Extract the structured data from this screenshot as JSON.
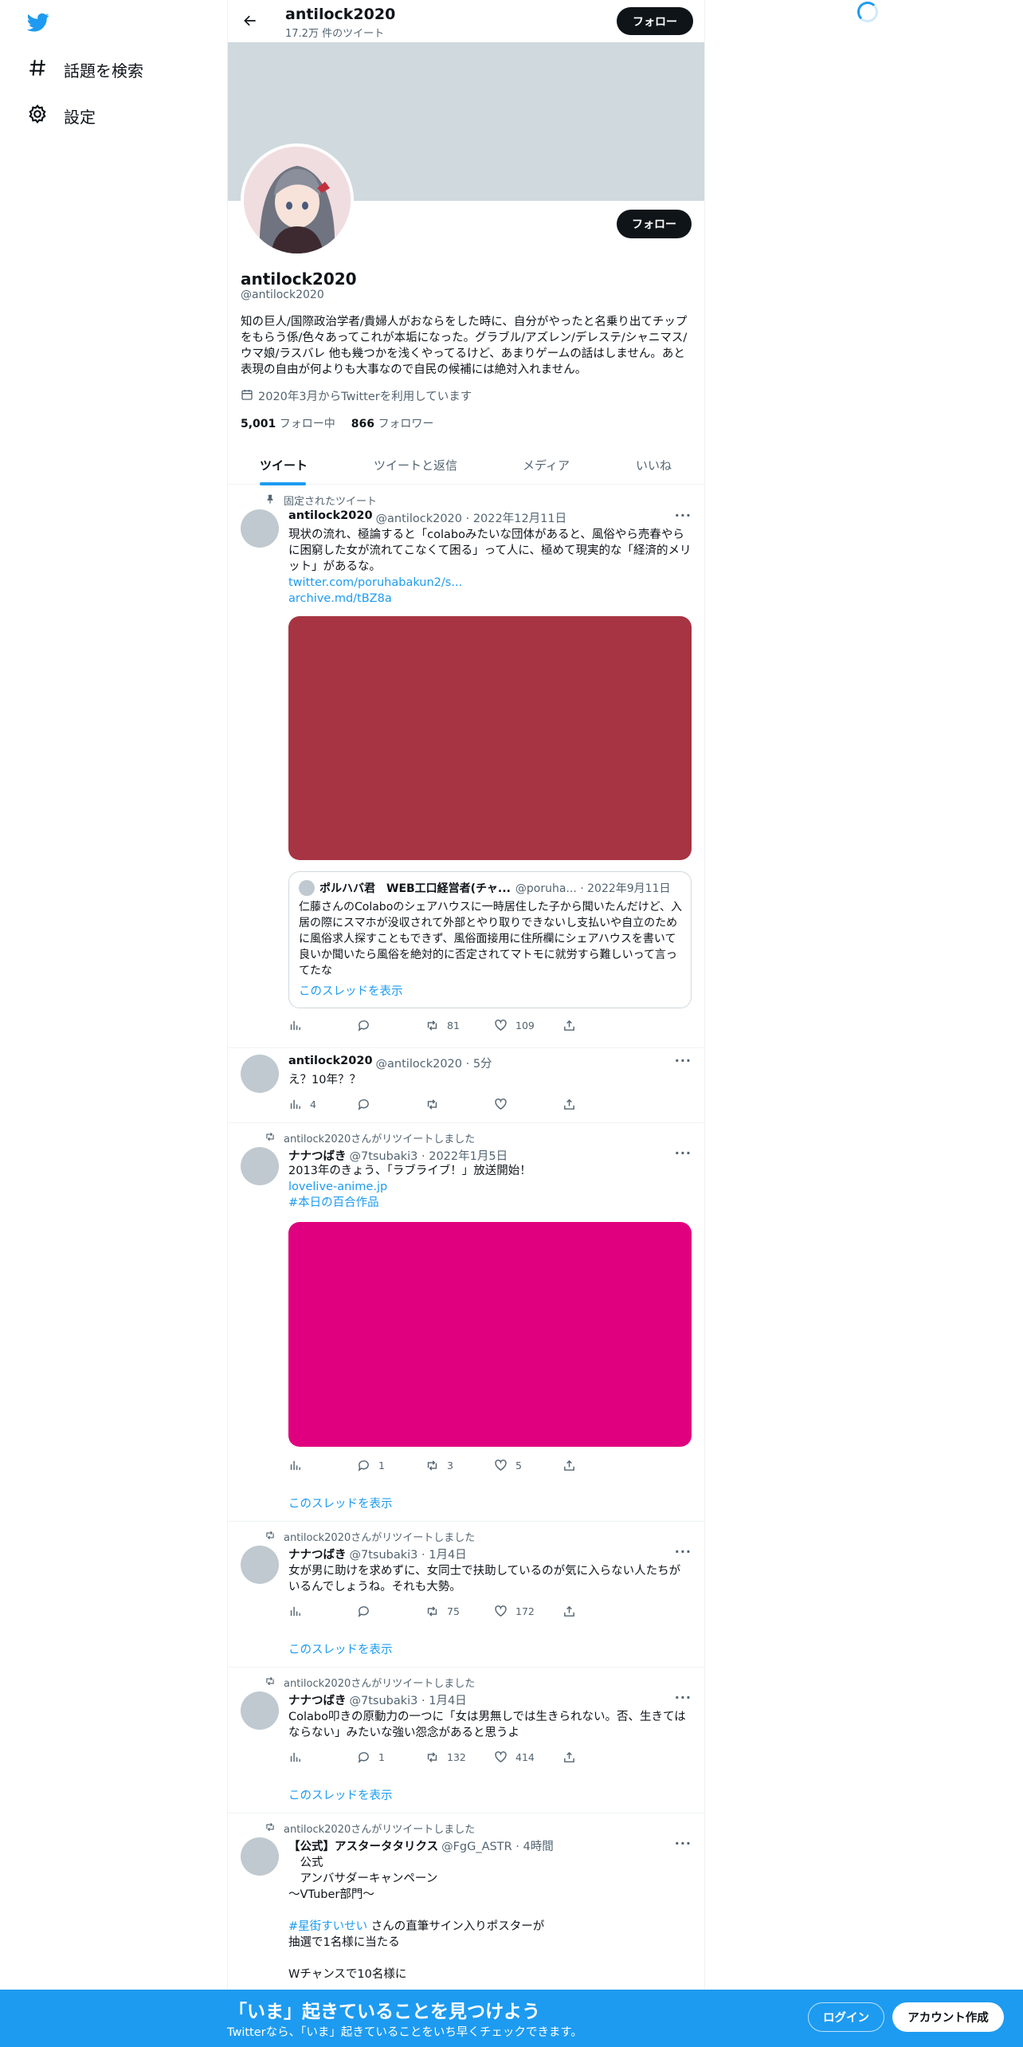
{
  "sidebar": {
    "logo_icon": "twitter-bird-icon",
    "items": [
      {
        "label": "話題を検索",
        "icon": "hashtag-icon"
      },
      {
        "label": "設定",
        "icon": "gear-icon"
      }
    ]
  },
  "header": {
    "name": "antilock2020",
    "tweet_count": "17.2万 件のツイート",
    "follow_label": "フォロー"
  },
  "profile": {
    "name": "antilock2020",
    "handle": "@antilock2020",
    "follow_label": "フォロー",
    "bio": "知の巨人/国際政治学者/貴婦人がおならをした時に、自分がやったと名乗り出てチップをもらう係/色々あってこれが本垢になった。グラブル/アズレン/デレステ/シャニマス/ウマ娘/ラスバレ 他も幾つかを浅くやってるけど、あまりゲームの話はしません。あと表現の自由が何よりも大事なので自民の候補には絶対入れません。",
    "joined": "2020年3月からTwitterを利用しています",
    "following_count": "5,001",
    "following_label": "フォロー中",
    "followers_count": "866",
    "followers_label": "フォロワー"
  },
  "tabs": [
    "ツイート",
    "ツイートと返信",
    "メディア",
    "いいね"
  ],
  "tweets": [
    {
      "context": "固定されたツイート",
      "name": "antilock2020",
      "meta": "@antilock2020 · 2022年12月11日",
      "text": "現状の流れ、極論すると「colaboみたいな団体があると、風俗やら売春やらに困窮した女が流れてこなくて困る」って人に、極めて現実的な「経済的メリット」があるな。",
      "link1": "twitter.com/poruhabakun2/s...",
      "link2": "archive.md/tBZ8a",
      "media_color": "#a73442",
      "quote": {
        "name": "ポルハバ君　WEB工口経営者(チャ...",
        "meta": "@poruha... · 2022年9月11日",
        "text": "仁藤さんのColaboのシェアハウスに一時居住した子から聞いたんだけど、入居の際にスマホが没収されて外部とやり取りできないし支払いや自立のために風俗求人探すこともできず、風俗面接用に住所欄にシェアハウスを書いて良いか聞いたら風俗を絶対的に否定されてマトモに就労すら難しいって言ってたな",
        "thread": "このスレッドを表示"
      },
      "stats": {
        "views": "",
        "replies": "",
        "retweets": "81",
        "likes": "109"
      }
    },
    {
      "name": "antilock2020",
      "meta": "@antilock2020 · 5分",
      "text": "え？10年？？",
      "stats": {
        "views": "4",
        "replies": "",
        "retweets": "",
        "likes": ""
      }
    },
    {
      "context": "antilock2020さんがリツイートしました",
      "name": "ナナつばき",
      "meta": "@7tsubaki3 · 2022年1月5日",
      "text": "2013年のきょう、「ラブライブ！」放送開始！",
      "link1": "lovelive-anime.jp",
      "link2": "#本日の百合作品",
      "media_color": "#e0007f",
      "stats": {
        "views": "",
        "replies": "1",
        "retweets": "3",
        "likes": "5"
      },
      "thread": "このスレッドを表示"
    },
    {
      "context": "antilock2020さんがリツイートしました",
      "name": "ナナつばき",
      "meta": "@7tsubaki3 · 1月4日",
      "text": "女が男に助けを求めずに、女同士で扶助しているのが気に入らない人たちがいるんでしょうね。それも大勢。",
      "stats": {
        "views": "",
        "replies": "",
        "retweets": "75",
        "likes": "172"
      },
      "thread": "このスレッドを表示"
    },
    {
      "context": "antilock2020さんがリツイートしました",
      "name": "ナナつばき",
      "meta": "@7tsubaki3 · 1月4日",
      "text": "Colabo叩きの原動力の一つに「女は男無しでは生きられない。否、生きてはならない」みたいな強い怨念があると思うよ",
      "stats": {
        "views": "",
        "replies": "1",
        "retweets": "132",
        "likes": "414"
      },
      "thread": "このスレッドを表示"
    },
    {
      "context": "antilock2020さんがリツイートしました",
      "name": "【公式】アスタータタリクス",
      "meta": "@FgG_ASTR · 4時間",
      "line1": "　公式",
      "line2": "　アンバサダーキャンペーン",
      "line3": "〜VTuber部門〜",
      "hashtag": "#星街すいせい",
      "line4": " さんの直筆サイン入りポスターが",
      "line5": "抽選で1名様に当たる",
      "line6": "Wチャンスで10名様に"
    }
  ],
  "bottom_banner": {
    "title": "「いま」起きていることを見つけよう",
    "subtitle": "Twitterなら、「いま」起きていることをいち早くチェックできます。",
    "login": "ログイン",
    "signup": "アカウント作成"
  },
  "colors": {
    "accent": "#1d9bf0",
    "banner_bg": "#cfd9de",
    "dark_button": "#0f1419"
  }
}
